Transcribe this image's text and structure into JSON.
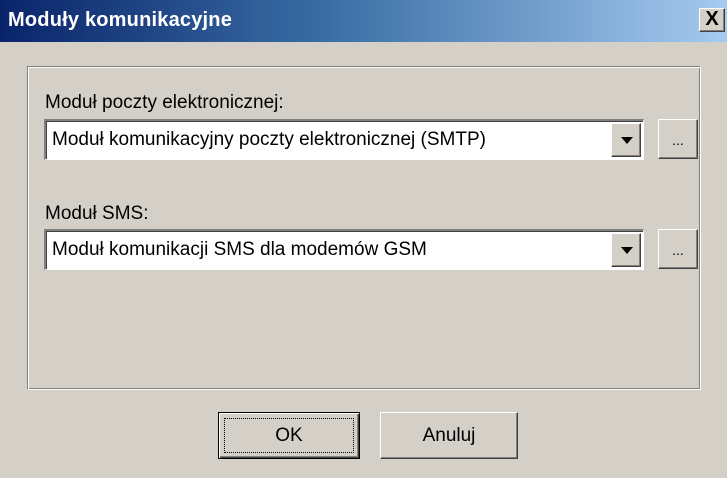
{
  "window": {
    "title": "Moduły komunikacyjne",
    "close_label": "X"
  },
  "email": {
    "label": "Moduł poczty elektronicznej:",
    "selected": "Moduł komunikacyjny poczty elektronicznej (SMTP)",
    "browse_label": "..."
  },
  "sms": {
    "label": "Moduł SMS:",
    "selected": "Moduł komunikacji SMS dla modemów GSM",
    "browse_label": "..."
  },
  "buttons": {
    "ok_label": "OK",
    "cancel_label": "Anuluj"
  },
  "colors": {
    "titlebar_start": "#0a246a",
    "titlebar_end": "#a6caf0",
    "face": "#d4d0c8"
  },
  "icons": {
    "dropdown": "chevron-down-icon",
    "close": "close-icon"
  }
}
